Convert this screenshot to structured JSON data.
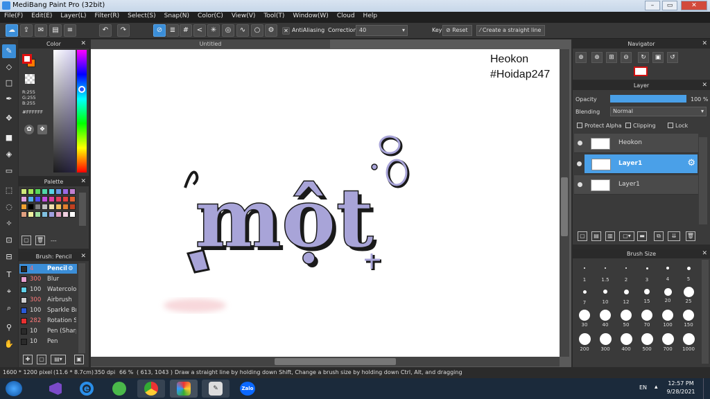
{
  "window": {
    "title": "MediBang Paint Pro (32bit)",
    "min": "–",
    "max": "▭",
    "close": "✕"
  },
  "menu": [
    "File(F)",
    "Edit(E)",
    "Layer(L)",
    "Filter(R)",
    "Select(S)",
    "Snap(N)",
    "Color(C)",
    "View(V)",
    "Tool(T)",
    "Window(W)",
    "Cloud",
    "Help"
  ],
  "toolbar": {
    "antialiasing_label": "AntiAliasing",
    "correction_label": "Correction",
    "correction_value": "40",
    "key_label": "Key",
    "reset_label": "Reset",
    "straight_line_label": "Create a straight line"
  },
  "color_panel": {
    "title": "Color",
    "r": "R:255",
    "g": "G:255",
    "b": "B:255",
    "hex": "#FFFFFF",
    "primary": "#ff0000",
    "secondary": "#ffa500"
  },
  "palette_panel": {
    "title": "Palette",
    "footer": "---",
    "colors": [
      "#cfe87a",
      "#a2e45a",
      "#58d85a",
      "#50d6a8",
      "#58d4e6",
      "#6a9ae6",
      "#9a6ae6",
      "#c080d0",
      "#e0a0e0",
      "#50b0f0",
      "#5050f0",
      "#c050e0",
      "#e040a0",
      "#e04060",
      "#e04040",
      "#e06030",
      "#f0a030",
      "#000000",
      "#808080",
      "#c0c0c0",
      "#f0e0b0",
      "#f0c060",
      "#e08030",
      "#c04020",
      "#e0a080",
      "#f0f0a0",
      "#a0e0a0",
      "#80c0e0",
      "#a0a0e0",
      "#e0a0c0",
      "#f0d0e0",
      "#ffffff"
    ]
  },
  "brush_panel": {
    "title": "Brush: Pencil",
    "brushes": [
      {
        "size": "4",
        "name": "Pencil",
        "color": "#2a2a2a"
      },
      {
        "size": "300",
        "name": "Blur",
        "color": "#e8a0d0"
      },
      {
        "size": "100",
        "name": "Watercolor",
        "color": "#60d0e8"
      },
      {
        "size": "300",
        "name": "Airbrush",
        "color": "#d0d0d0"
      },
      {
        "size": "100",
        "name": "Sparkle Br",
        "color": "#2a5ad8"
      },
      {
        "size": "282",
        "name": "Rotation S",
        "color": "#e83030"
      },
      {
        "size": "10",
        "name": "Pen (Sharp",
        "color": "#2a2a2a"
      },
      {
        "size": "10",
        "name": "Pen",
        "color": "#2a2a2a"
      }
    ]
  },
  "document": {
    "tab": "Untitled"
  },
  "canvas": {
    "watermark_line1": "Heokon",
    "watermark_line2": "#Hoidap247",
    "drawing_text": "một"
  },
  "navigator": {
    "title": "Navigator"
  },
  "layer_panel": {
    "title": "Layer",
    "opacity_label": "Opacity",
    "opacity_value": "100 %",
    "opacity_fraction": 1.0,
    "blending_label": "Blending",
    "blending_value": "Normal",
    "protect_alpha": "Protect Alpha",
    "clipping": "Clipping",
    "lock": "Lock",
    "layers": [
      {
        "name": "Heokon",
        "selected": false
      },
      {
        "name": "Layer1",
        "selected": true
      },
      {
        "name": "Layer1",
        "selected": false
      }
    ]
  },
  "brush_size_panel": {
    "title": "Brush Size",
    "sizes": [
      "1",
      "1.5",
      "2",
      "3",
      "4",
      "5",
      "7",
      "10",
      "12",
      "15",
      "20",
      "25",
      "30",
      "40",
      "50",
      "70",
      "100",
      "150",
      "200",
      "300",
      "400",
      "500",
      "700",
      "1000"
    ]
  },
  "status": {
    "dimensions": "1600 * 1200 pixel",
    "cm": "(11.6 * 8.7cm)",
    "dpi": "350 dpi",
    "zoom": "66 %",
    "coords": "( 613, 1043 )",
    "hint": "Draw a straight line by holding down Shift, Change a brush size by holding down Ctrl, Alt, and dragging"
  },
  "taskbar": {
    "lang": "EN",
    "time": "12:57 PM",
    "date": "9/28/2021",
    "zalo": "Zalo"
  },
  "colors": {
    "accent": "#3b8ed8",
    "ink": "#a8a4d8",
    "shadow": "#1a1a1a"
  }
}
